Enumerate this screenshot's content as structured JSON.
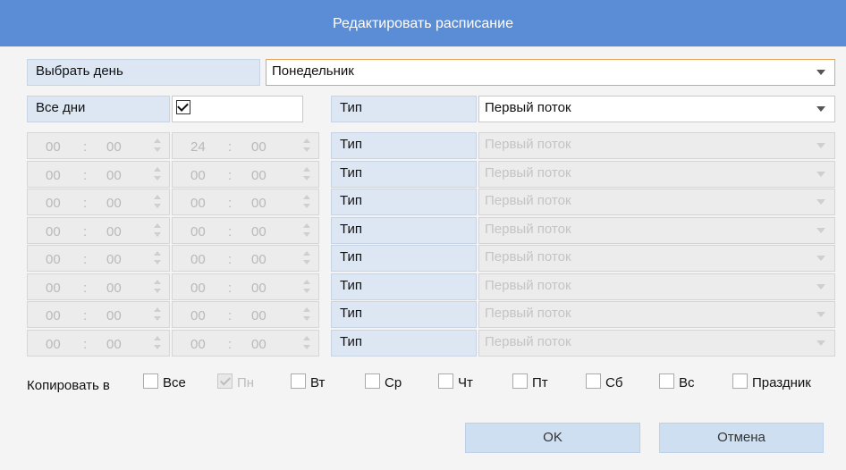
{
  "title": "Редактировать расписание",
  "select_day": {
    "label": "Выбрать день",
    "value": "Понедельник"
  },
  "all_days": {
    "label": "Все дни",
    "checked": true
  },
  "type_main": {
    "label": "Тип",
    "value": "Первый поток"
  },
  "rows": [
    {
      "start_h": "00",
      "start_m": "00",
      "end_h": "24",
      "end_m": "00",
      "type_label": "Тип",
      "type_value": "Первый поток"
    },
    {
      "start_h": "00",
      "start_m": "00",
      "end_h": "00",
      "end_m": "00",
      "type_label": "Тип",
      "type_value": "Первый поток"
    },
    {
      "start_h": "00",
      "start_m": "00",
      "end_h": "00",
      "end_m": "00",
      "type_label": "Тип",
      "type_value": "Первый поток"
    },
    {
      "start_h": "00",
      "start_m": "00",
      "end_h": "00",
      "end_m": "00",
      "type_label": "Тип",
      "type_value": "Первый поток"
    },
    {
      "start_h": "00",
      "start_m": "00",
      "end_h": "00",
      "end_m": "00",
      "type_label": "Тип",
      "type_value": "Первый поток"
    },
    {
      "start_h": "00",
      "start_m": "00",
      "end_h": "00",
      "end_m": "00",
      "type_label": "Тип",
      "type_value": "Первый поток"
    },
    {
      "start_h": "00",
      "start_m": "00",
      "end_h": "00",
      "end_m": "00",
      "type_label": "Тип",
      "type_value": "Первый поток"
    },
    {
      "start_h": "00",
      "start_m": "00",
      "end_h": "00",
      "end_m": "00",
      "type_label": "Тип",
      "type_value": "Первый поток"
    }
  ],
  "time_separator": ":",
  "copy": {
    "label": "Копировать в",
    "options": [
      {
        "label": "Все",
        "checked": false
      },
      {
        "label": "Пн",
        "checked": true
      },
      {
        "label": "Вт",
        "checked": false
      },
      {
        "label": "Ср",
        "checked": false
      },
      {
        "label": "Чт",
        "checked": false
      },
      {
        "label": "Пт",
        "checked": false
      },
      {
        "label": "Сб",
        "checked": false
      },
      {
        "label": "Вс",
        "checked": false
      },
      {
        "label": "Праздник",
        "checked": false
      }
    ]
  },
  "buttons": {
    "ok": "OK",
    "cancel": "Отмена"
  },
  "colors": {
    "titlebar": "#5b8dd6",
    "label_bg": "#dde7f4",
    "focus_border": "#e7a45b",
    "button_bg": "#cfdff2"
  }
}
